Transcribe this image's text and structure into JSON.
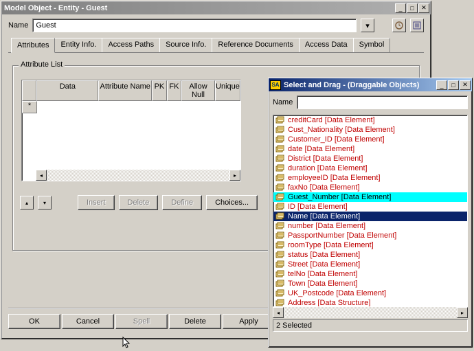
{
  "mainWindow": {
    "title": "Model Object - Entity - Guest",
    "nameLabel": "Name",
    "nameValue": "Guest",
    "tabs": [
      "Attributes",
      "Entity Info.",
      "Access Paths",
      "Source Info.",
      "Reference Documents",
      "Access Data",
      "Symbol"
    ],
    "activeTab": 0,
    "group": {
      "legend": "Attribute List",
      "columns": [
        "",
        "Data",
        "Attribute Name",
        "PK",
        "FK",
        "Allow Null",
        "Unique"
      ],
      "rowMarker": "*",
      "buttons": {
        "insert": "Insert",
        "delete": "Delete",
        "define": "Define",
        "choices": "Choices..."
      }
    },
    "bottom": {
      "ok": "OK",
      "cancel": "Cancel",
      "spell": "Spell",
      "delete": "Delete",
      "apply": "Apply"
    }
  },
  "dragWindow": {
    "badge": "SA",
    "title": "Select and Drag - (Draggable Objects)",
    "nameLabel": "Name",
    "nameValue": "",
    "items": [
      {
        "label": "creditCard  [Data Element]",
        "sel": 0
      },
      {
        "label": "Cust_Nationality  [Data Element]",
        "sel": 0
      },
      {
        "label": "Customer_ID  [Data Element]",
        "sel": 0
      },
      {
        "label": "date  [Data Element]",
        "sel": 0
      },
      {
        "label": "District  [Data Element]",
        "sel": 0
      },
      {
        "label": "duration  [Data Element]",
        "sel": 0
      },
      {
        "label": "employeeID  [Data Element]",
        "sel": 0
      },
      {
        "label": "faxNo  [Data Element]",
        "sel": 0
      },
      {
        "label": "Guest_Number  [Data Element]",
        "sel": 2
      },
      {
        "label": "ID  [Data Element]",
        "sel": 0
      },
      {
        "label": "Name  [Data Element]",
        "sel": 1
      },
      {
        "label": "number  [Data Element]",
        "sel": 0
      },
      {
        "label": "PassportNumber  [Data Element]",
        "sel": 0
      },
      {
        "label": "roomType  [Data Element]",
        "sel": 0
      },
      {
        "label": "status  [Data Element]",
        "sel": 0
      },
      {
        "label": "Street  [Data Element]",
        "sel": 0
      },
      {
        "label": "telNo  [Data Element]",
        "sel": 0
      },
      {
        "label": "Town  [Data Element]",
        "sel": 0
      },
      {
        "label": "UK_Postcode  [Data Element]",
        "sel": 0
      },
      {
        "label": "Address  [Data Structure]",
        "sel": 0
      }
    ],
    "status": "2 Selected"
  }
}
